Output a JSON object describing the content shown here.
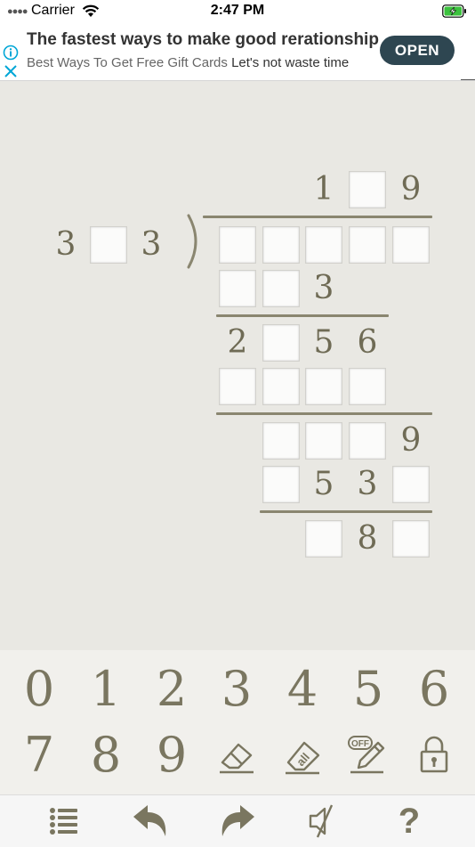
{
  "status": {
    "carrier": "Carrier",
    "time": "2:47 PM"
  },
  "ad": {
    "title": "The fastest ways to make good rerationship",
    "subtitle": "Best Ways To Get Free Gift Cards",
    "subtitle_tail": "Let's not waste time",
    "open_label": "OPEN"
  },
  "puzzle": {
    "quotient": [
      "1",
      "",
      "9"
    ],
    "divisor": [
      "3",
      "",
      "3"
    ],
    "row2": [
      "",
      "",
      "3"
    ],
    "row3": [
      "2",
      "",
      "5",
      "6"
    ],
    "row5": [
      "",
      "",
      "",
      "9"
    ],
    "row6": [
      "",
      "5",
      "3",
      ""
    ],
    "row7": [
      "",
      "8",
      ""
    ]
  },
  "keypad": {
    "digits": [
      "0",
      "1",
      "2",
      "3",
      "4",
      "5",
      "6",
      "7",
      "8",
      "9"
    ],
    "eraser_label": "all",
    "pencil_label": "OFF"
  },
  "toolbar": {
    "help_label": "?"
  },
  "colors": {
    "ink": "#6f6b55",
    "ad_button": "#2e4651",
    "background": "#e9e8e3"
  }
}
